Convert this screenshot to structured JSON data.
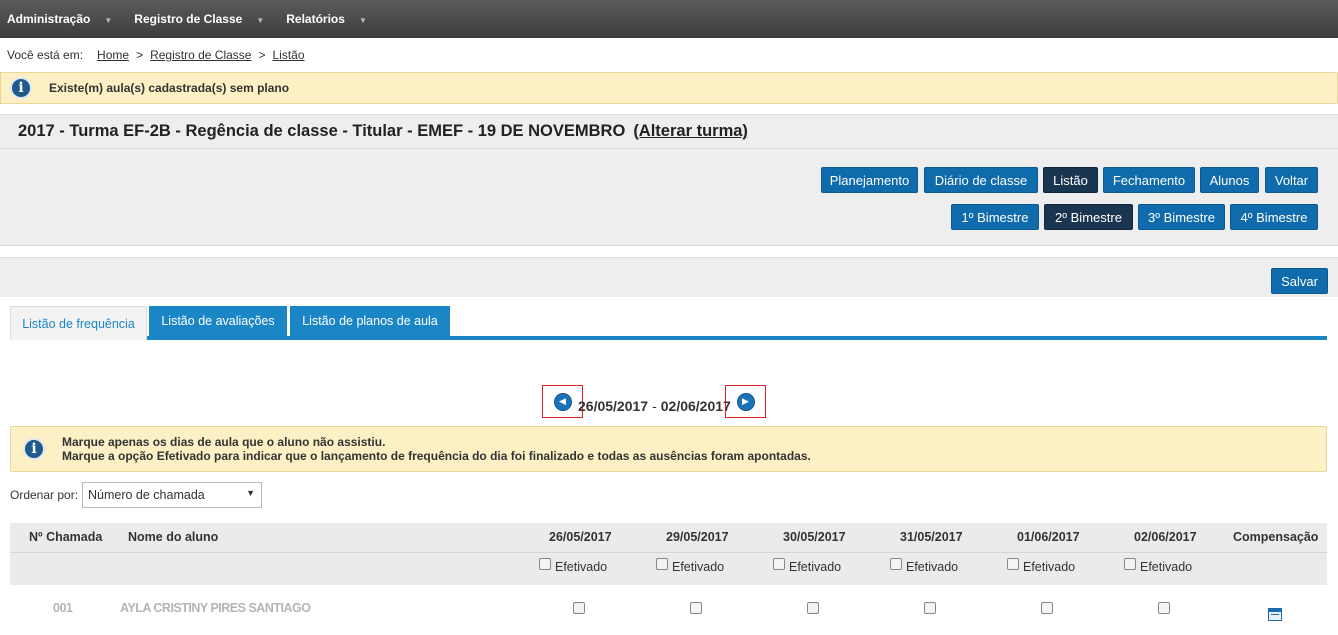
{
  "topnav": {
    "items": [
      {
        "label": "Administração"
      },
      {
        "label": "Registro de Classe"
      },
      {
        "label": "Relatórios"
      }
    ],
    "caret": "▼"
  },
  "breadcrumb": {
    "prefix": "Você está em:",
    "links": [
      "Home",
      "Registro de Classe",
      "Listão"
    ],
    "separator": ">"
  },
  "alert_top": {
    "text": "Existe(m) aula(s) cadastrada(s) sem plano"
  },
  "class_header": {
    "title": "2017 - Turma EF-2B - Regência de classe - Titular - EMEF - 19 DE NOVEMBRO",
    "change_link": "(Alterar turma)"
  },
  "action_buttons": [
    {
      "label": "Planejamento",
      "active": false
    },
    {
      "label": "Diário de classe",
      "active": false
    },
    {
      "label": "Listão",
      "active": true
    },
    {
      "label": "Fechamento",
      "active": false
    },
    {
      "label": "Alunos",
      "active": false
    },
    {
      "label": "Voltar",
      "active": false
    }
  ],
  "bimester_buttons": [
    {
      "label": "1º Bimestre",
      "active": false
    },
    {
      "label": "2º Bimestre",
      "active": true
    },
    {
      "label": "3º Bimestre",
      "active": false
    },
    {
      "label": "4º Bimestre",
      "active": false
    }
  ],
  "save_button": {
    "label": "Salvar"
  },
  "tabs": [
    {
      "label": "Listão de frequência",
      "active": true
    },
    {
      "label": "Listão de avaliações",
      "active": false
    },
    {
      "label": "Listão de planos de aula",
      "active": false
    }
  ],
  "date_range": {
    "start": "26/05/2017",
    "separator": "-",
    "end": "02/06/2017"
  },
  "alert_mid": {
    "line1": "Marque apenas os dias de aula que o aluno não assistiu.",
    "line2": "Marque a opção Efetivado para indicar que o lançamento de frequência do dia foi finalizado e todas as ausências foram apontadas."
  },
  "order": {
    "label": "Ordenar por:",
    "selected": "Número de chamada"
  },
  "table": {
    "headers": {
      "number": "Nº Chamada",
      "name": "Nome do aluno",
      "compensation": "Compensação"
    },
    "dates": [
      "26/05/2017",
      "29/05/2017",
      "30/05/2017",
      "31/05/2017",
      "01/06/2017",
      "02/06/2017"
    ],
    "efetivado_label": "Efetivado",
    "rows": [
      {
        "number": "001",
        "name": "AYLA CRISTINY PIRES SANTIAGO"
      }
    ]
  },
  "colors": {
    "nav_bg": "#4a4a4a",
    "button_blue": "#0f6bab",
    "button_active": "#1a3550",
    "tab_blue": "#1b86c6",
    "alert_bg": "#fcf0c4",
    "highlight_box": "#e02020"
  },
  "icons": {
    "info": "info-circle-icon",
    "prev": "chevron-left-circle-icon",
    "next": "chevron-right-circle-icon",
    "compensation": "calendar-icon"
  }
}
